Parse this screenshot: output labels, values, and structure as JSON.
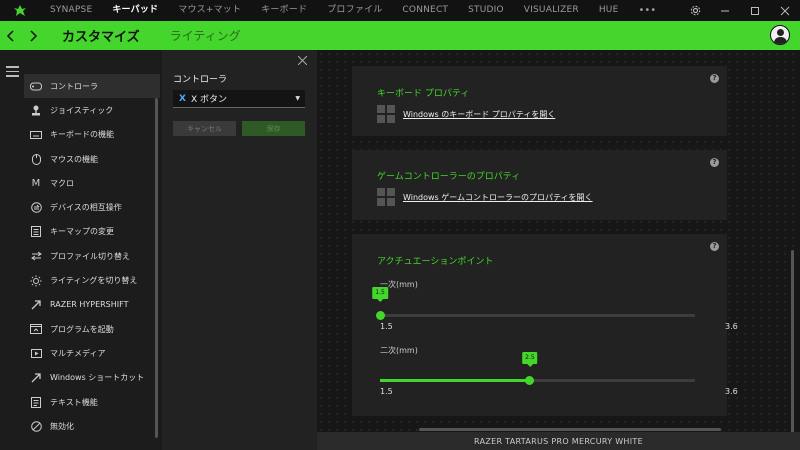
{
  "topnav": {
    "items": [
      "SYNAPSE",
      "キーパッド",
      "マウス+マット",
      "キーボード",
      "プロファイル",
      "CONNECT",
      "STUDIO",
      "VISUALIZER",
      "HUE"
    ],
    "active_index": 1,
    "more": "•••"
  },
  "header": {
    "title": "カスタマイズ",
    "tab": "ライティング"
  },
  "sidebar": {
    "items": [
      {
        "label": "コントローラ",
        "icon": "gamepad-icon"
      },
      {
        "label": "ジョイスティック",
        "icon": "joystick-icon"
      },
      {
        "label": "キーボードの機能",
        "icon": "keyboard-icon"
      },
      {
        "label": "マウスの機能",
        "icon": "mouse-icon"
      },
      {
        "label": "マクロ",
        "icon": "macro-icon"
      },
      {
        "label": "デバイスの相互操作",
        "icon": "interdevice-icon"
      },
      {
        "label": "キーマップの変更",
        "icon": "keymap-icon"
      },
      {
        "label": "プロファイル切り替え",
        "icon": "profile-switch-icon"
      },
      {
        "label": "ライティングを切り替え",
        "icon": "lighting-icon"
      },
      {
        "label": "RAZER HYPERSHIFT",
        "icon": "hypershift-icon"
      },
      {
        "label": "プログラムを起動",
        "icon": "launch-program-icon"
      },
      {
        "label": "マルチメディア",
        "icon": "multimedia-icon"
      },
      {
        "label": "Windows ショートカット",
        "icon": "windows-shortcut-icon"
      },
      {
        "label": "テキスト機能",
        "icon": "text-icon"
      },
      {
        "label": "無効化",
        "icon": "disable-icon"
      }
    ],
    "active_index": 0
  },
  "panel": {
    "label": "コントローラ",
    "select_badge": "X",
    "select_value": "X ボタン",
    "cancel": "キャンセル",
    "save": "保存"
  },
  "cards": {
    "keyboard": {
      "title": "キーボード プロパティ",
      "link": "Windows のキーボード プロパティを開く"
    },
    "gamepad": {
      "title": "ゲームコントローラーのプロパティ",
      "link": "Windows ゲームコントローラーのプロパティを開く"
    },
    "actuation": {
      "title": "アクチュエーションポイント",
      "primary": {
        "label": "一次(mm)",
        "value": "1.5",
        "fraction": 0.0,
        "min": "1.5",
        "max": "3.6"
      },
      "secondary": {
        "label": "二次(mm)",
        "value": "2.5",
        "fraction": 0.476,
        "min": "1.5",
        "max": "3.6"
      }
    },
    "help": "?"
  },
  "footer": {
    "device": "RAZER TARTARUS PRO MERCURY WHITE"
  },
  "colors": {
    "accent": "#44d62c"
  }
}
